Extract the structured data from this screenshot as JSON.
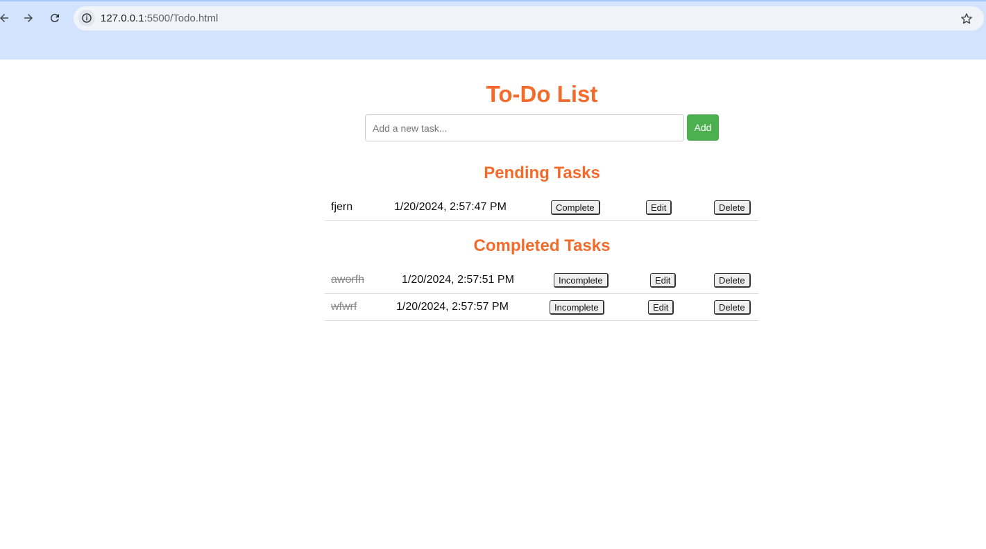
{
  "browser": {
    "url_host": "127.0.0.1",
    "url_rest": ":5500/Todo.html"
  },
  "page": {
    "title": "To-Do List",
    "input_placeholder": "Add a new task...",
    "input_value": "",
    "add_label": "Add",
    "pending_heading": "Pending Tasks",
    "completed_heading": "Completed Tasks"
  },
  "pending": [
    {
      "name": "fjern",
      "time": "1/20/2024, 2:57:47 PM",
      "toggle_label": "Complete",
      "edit_label": "Edit",
      "delete_label": "Delete"
    }
  ],
  "completed": [
    {
      "name": "aworfh",
      "time": "1/20/2024, 2:57:51 PM",
      "toggle_label": "Incomplete",
      "edit_label": "Edit",
      "delete_label": "Delete"
    },
    {
      "name": "wfwrf",
      "time": "1/20/2024, 2:57:57 PM",
      "toggle_label": "Incomplete",
      "edit_label": "Edit",
      "delete_label": "Delete"
    }
  ],
  "colors": {
    "accent": "#f26b2a",
    "add_button": "#4caf50",
    "chrome": "#d3e3fd"
  },
  "icons": {
    "back": "back-arrow-icon",
    "forward": "forward-arrow-icon",
    "reload": "reload-icon",
    "site_info": "info-icon",
    "bookmark": "star-icon"
  }
}
